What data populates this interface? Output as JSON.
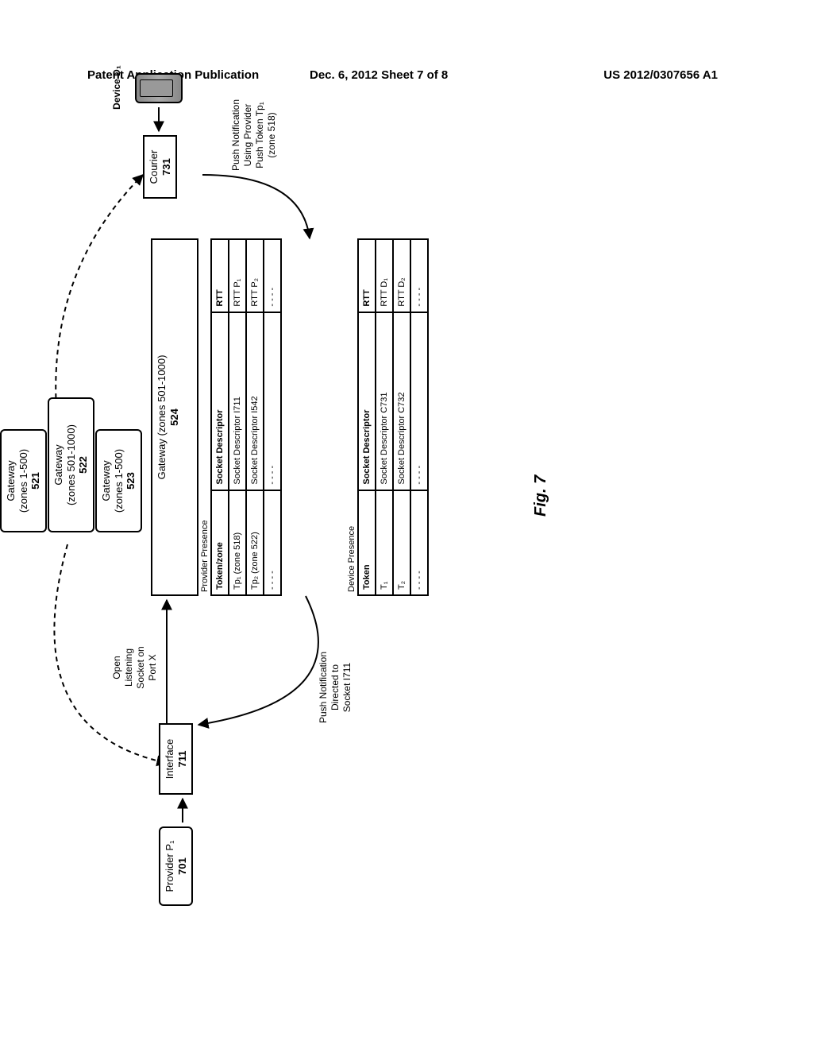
{
  "header": {
    "left": "Patent Application Publication",
    "center": "Dec. 6, 2012  Sheet 7 of 8",
    "right": "US 2012/0307656 A1"
  },
  "gateways": {
    "g521": {
      "line1": "Gateway",
      "line2": "(zones 1-500)",
      "num": "521"
    },
    "g522": {
      "line1": "Gateway",
      "line2": "(zones 501-1000)",
      "num": "522"
    },
    "g523": {
      "line1": "Gateway",
      "line2": "(zones 1-500)",
      "num": "523"
    },
    "g524": {
      "line1": "Gateway (zones 501-1000)",
      "num": "524"
    }
  },
  "provider_presence": {
    "title": "Provider Presence",
    "headers": {
      "c1": "Token/zone",
      "c2": "Socket Descriptor",
      "c3": "RTT"
    },
    "rows": [
      {
        "c1": "Tp₁ (zone 518)",
        "c2": "Socket Descriptor I711",
        "c3": "RTT P₁"
      },
      {
        "c1": "Tp₂ (zone 522)",
        "c2": "Socket Descriptor I542",
        "c3": "RTT P₂"
      },
      {
        "c1": "- - - -",
        "c2": "- - - -",
        "c3": "- - - -"
      }
    ]
  },
  "device_presence": {
    "title": "Device Presence",
    "headers": {
      "c1": "Token",
      "c2": "Socket Descriptor",
      "c3": "RTT"
    },
    "rows": [
      {
        "c1": "T₁",
        "c2": "Socket Descriptor C731",
        "c3": "RTT D₁"
      },
      {
        "c1": "T₂",
        "c2": "Socket Descriptor C732",
        "c3": "RTT D₂"
      },
      {
        "c1": "- - - -",
        "c2": "- - - -",
        "c3": "- - - -"
      }
    ]
  },
  "provider": {
    "label": "Provider P₁",
    "num": "701"
  },
  "interface": {
    "label": "Interface",
    "num": "711"
  },
  "courier": {
    "label": "Courier",
    "num": "731"
  },
  "device": {
    "label": "Device D₁"
  },
  "annotations": {
    "open_socket": "Open\nListening\nSocket on\nPort X",
    "push_i711": "Push Notification\nDirected to\nSocket I711",
    "push_token": "Push Notification\nUsing Provider\nPush Token Tp₁\n(zone 518)"
  },
  "figure": "Fig. 7"
}
